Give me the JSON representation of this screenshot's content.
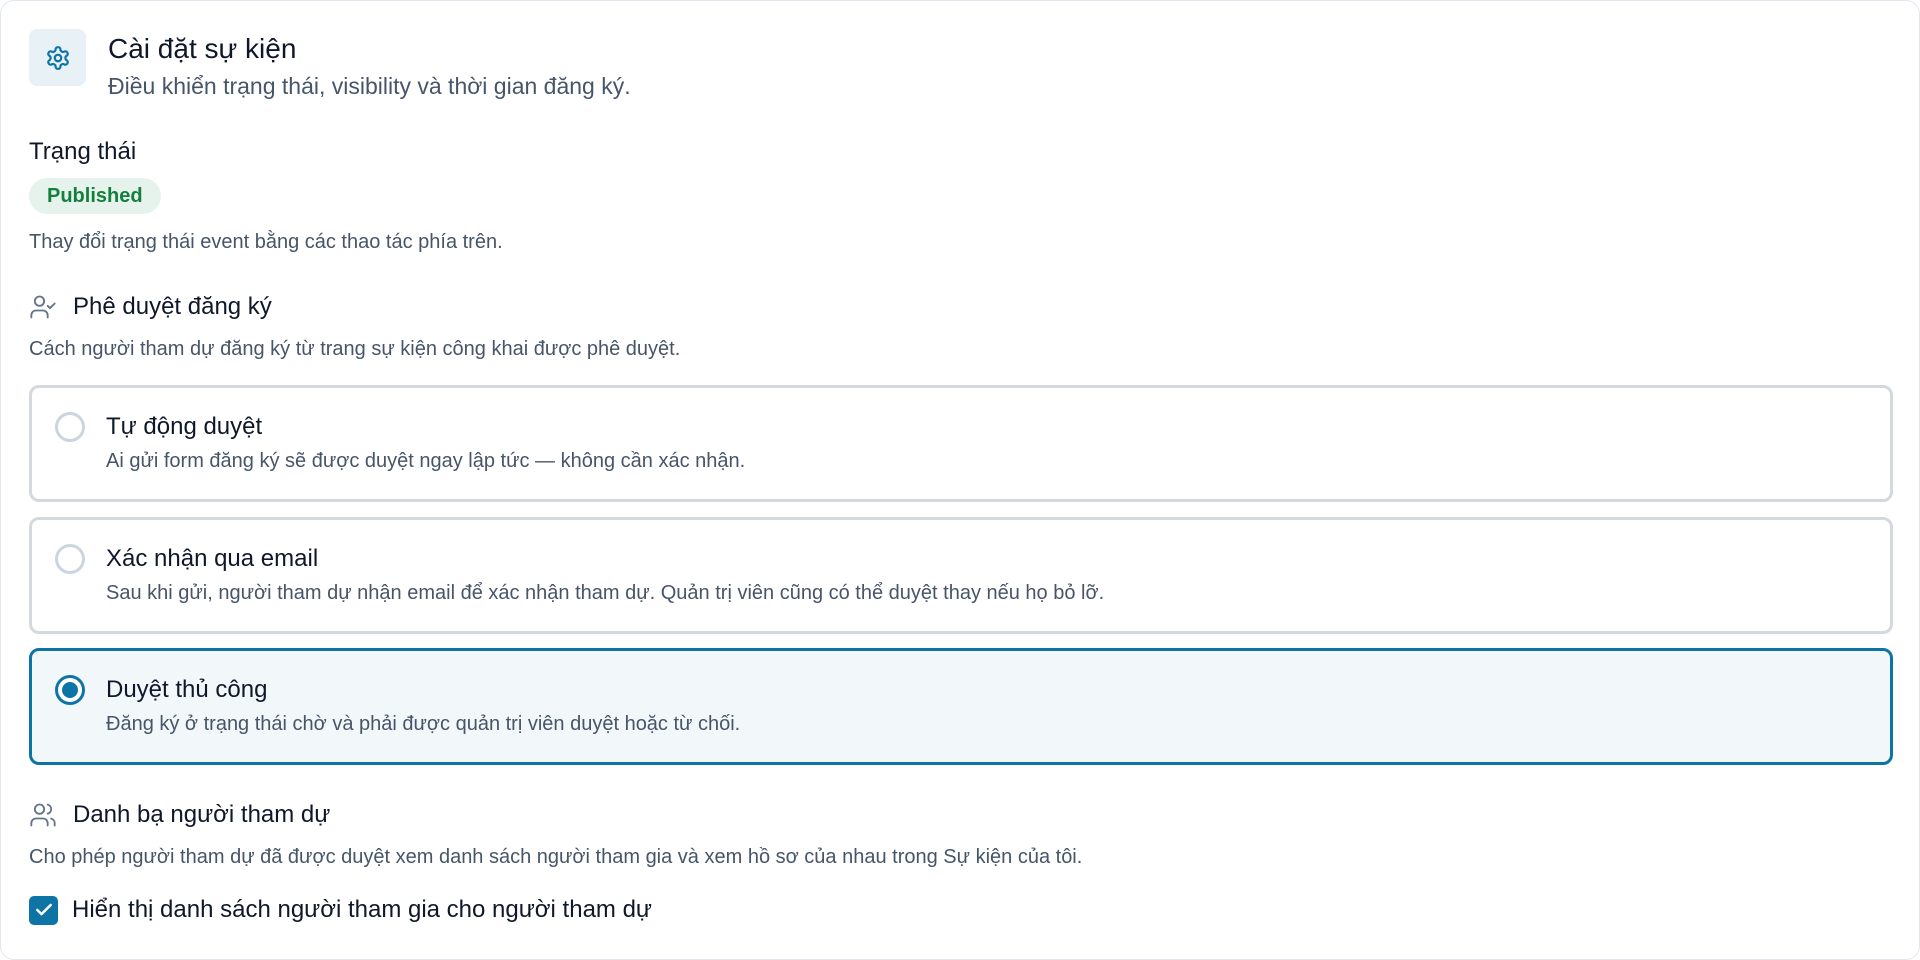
{
  "header": {
    "title": "Cài đặt sự kiện",
    "subtitle": "Điều khiển trạng thái, visibility và thời gian đăng ký.",
    "icon": "gear-icon"
  },
  "status": {
    "label": "Trạng thái",
    "badge": "Published",
    "help": "Thay đổi trạng thái event bằng các thao tác phía trên."
  },
  "approval": {
    "title": "Phê duyệt đăng ký",
    "icon": "user-check-icon",
    "help": "Cách người tham dự đăng ký từ trang sự kiện công khai được phê duyệt.",
    "options": [
      {
        "title": "Tự động duyệt",
        "desc": "Ai gửi form đăng ký sẽ được duyệt ngay lập tức — không cần xác nhận.",
        "selected": false
      },
      {
        "title": "Xác nhận qua email",
        "desc": "Sau khi gửi, người tham dự nhận email để xác nhận tham dự. Quản trị viên cũng có thể duyệt thay nếu họ bỏ lỡ.",
        "selected": false
      },
      {
        "title": "Duyệt thủ công",
        "desc": "Đăng ký ở trạng thái chờ và phải được quản trị viên duyệt hoặc từ chối.",
        "selected": true
      }
    ]
  },
  "directory": {
    "title": "Danh bạ người tham dự",
    "icon": "users-icon",
    "help": "Cho phép người tham dự đã được duyệt xem danh sách người tham gia và xem hồ sơ của nhau trong Sự kiện của tôi.",
    "checkbox_label": "Hiển thị danh sách người tham gia cho người tham dự",
    "checked": true
  },
  "colors": {
    "accent": "#0e74a6",
    "badge_bg": "#e5f3ec",
    "badge_text": "#15803d"
  }
}
